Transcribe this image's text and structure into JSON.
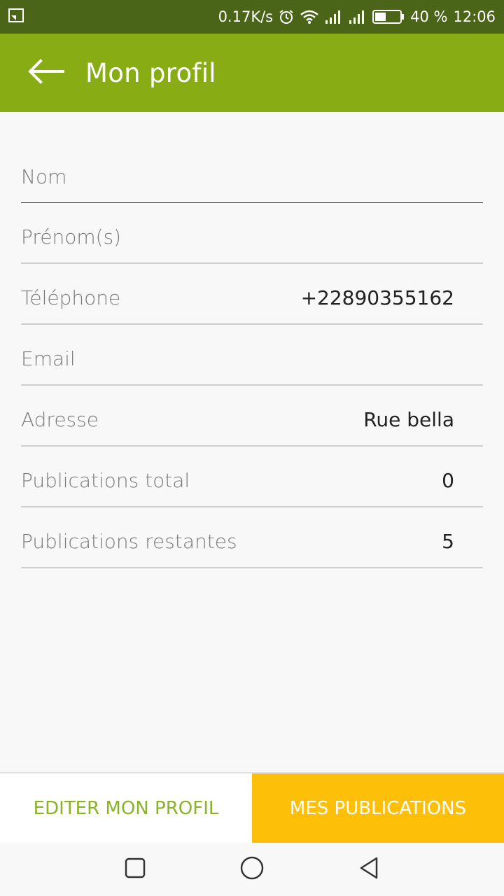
{
  "status_bar": {
    "net_speed": "0.17K/s",
    "battery": "40 %",
    "time": "12:06"
  },
  "app_bar": {
    "title": "Mon profil"
  },
  "profile": {
    "fields": [
      {
        "label": "Nom",
        "value": ""
      },
      {
        "label": "Prénom(s)",
        "value": ""
      },
      {
        "label": "Téléphone",
        "value": "+22890355162"
      },
      {
        "label": "Email",
        "value": ""
      },
      {
        "label": "Adresse",
        "value": "Rue bella"
      },
      {
        "label": "Publications total",
        "value": "0"
      },
      {
        "label": "Publications restantes",
        "value": "5"
      }
    ]
  },
  "actions": {
    "edit_label": "EDITER MON PROFIL",
    "publications_label": "MES PUBLICATIONS"
  },
  "colors": {
    "status_bar": "#4a6418",
    "app_bar": "#88ac14",
    "edit_text": "#8ab32a",
    "publications_bg": "#fdbf07"
  },
  "icons": {
    "back": "arrow-left-icon",
    "cast": "cast-icon",
    "alarm": "alarm-icon",
    "wifi": "wifi-icon",
    "signal": "signal-icon",
    "battery": "battery-icon",
    "nav_recents": "square-icon",
    "nav_home": "circle-icon",
    "nav_back": "triangle-back-icon"
  }
}
